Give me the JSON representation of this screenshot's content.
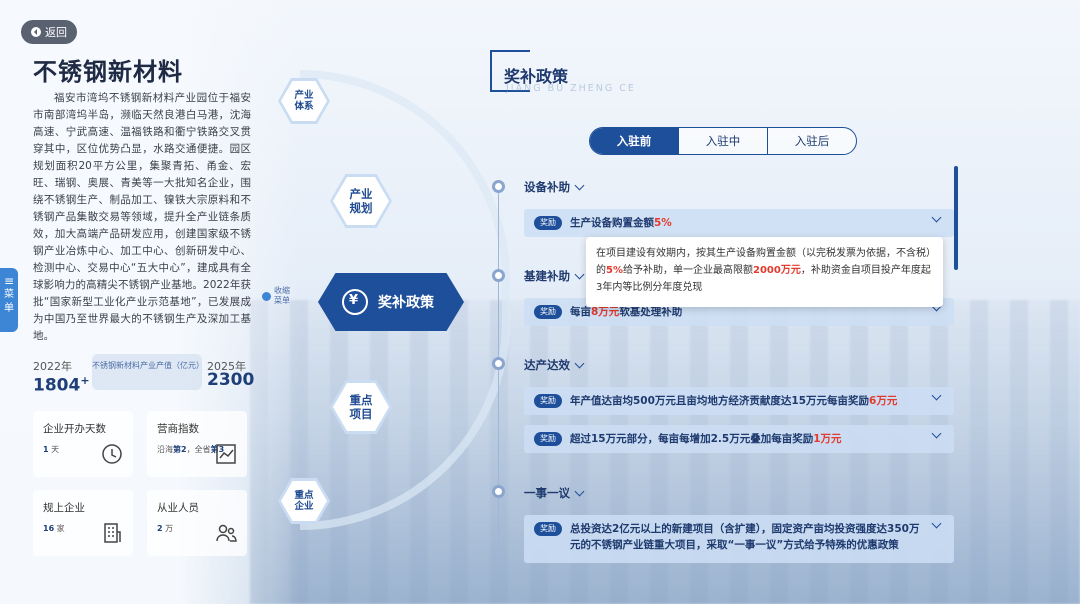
{
  "back_label": "返回",
  "title": "不锈钢新材料",
  "intro": "福安市湾坞不锈钢新材料产业园位于福安市南部湾坞半岛，濒临天然良港白马港，沈海高速、宁武高速、温福铁路和衢宁铁路交叉贯穿其中，区位优势凸显，水路交通便捷。园区规划面积20平方公里，集聚青拓、甬金、宏旺、瑞钢、奥展、青美等一大批知名企业，围绕不锈钢生产、制品加工、镍铁大宗原料和不锈钢产品集散交易等领域，提升全产业链条质效，加大高端产品研发应用，创建国家级不锈钢产业冶炼中心、加工中心、创新研发中心、检测中心、交易中心“五大中心”，建成具有全球影响力的高精尖不锈钢产业基地。2022年获批“国家新型工业化产业示范基地”，已发展成为中国乃至世界最大的不锈钢生产及深加工基地。",
  "stats": {
    "year_left": "2022年",
    "value_left": "1804",
    "value_left_sup": "+",
    "middle_label": "不锈钢新材料产业产值（亿元）",
    "year_right": "2025年",
    "value_right": "2300"
  },
  "cards": [
    {
      "title": "企业开办天数",
      "value_num": "1",
      "value_unit": " 天",
      "icon": "clock-icon"
    },
    {
      "title": "营商指数",
      "value_text_1": "沿海",
      "value_num_1": "第2",
      "value_text_2": "，全省",
      "value_num_2": "第3",
      "icon": "chart-icon"
    },
    {
      "title": "规上企业",
      "value_num": "16",
      "value_unit": " 家",
      "icon": "building-icon"
    },
    {
      "title": "从业人员",
      "value_num": "2",
      "value_unit": " 万",
      "icon": "people-icon"
    }
  ],
  "side_menu": "菜单",
  "nav": {
    "item1": "产业体系",
    "item2": "产业规划",
    "active": "奖补政策",
    "item4": "重点项目",
    "item5": "重点企业",
    "collapse": "收缩菜单"
  },
  "section": {
    "title": "奖补政策",
    "subtitle": "JIANG BU ZHENG CE"
  },
  "tabs": [
    "入驻前",
    "入驻中",
    "入驻后"
  ],
  "groups": [
    {
      "label": "设备补助"
    },
    {
      "label": "基建补助"
    },
    {
      "label": "达产达效"
    },
    {
      "label": "一事一议"
    }
  ],
  "badge": "奖励",
  "items": {
    "i1_text": "生产设备购置金额",
    "i1_red": "5%",
    "i2_text_a": "每亩",
    "i2_red": "8万元",
    "i2_text_b": "软基处理补助",
    "i3_text": "年产值达亩均500万元且亩均地方经济贡献度达15万元每亩奖励",
    "i3_red": "6万元",
    "i4_text": "超过15万元部分，每亩每增加2.5万元叠加每亩奖励",
    "i4_red": "1万元",
    "i5_text": "总投资达2亿元以上的新建项目（含扩建），固定资产亩均投资强度达350万元的不锈钢产业链重大项目，采取“一事一议”方式给予特殊的优惠政策"
  },
  "popup": {
    "text_a": "在项目建设有效期内，按其生产设备购置金额（以完税发票为依据，不含税）的",
    "red_1": "5%",
    "text_b": "给予补助，单一企业最高限额",
    "red_2": "2000万元",
    "text_c": "，补助资金自项目投产年度起3年内等比例分年度兑现"
  }
}
